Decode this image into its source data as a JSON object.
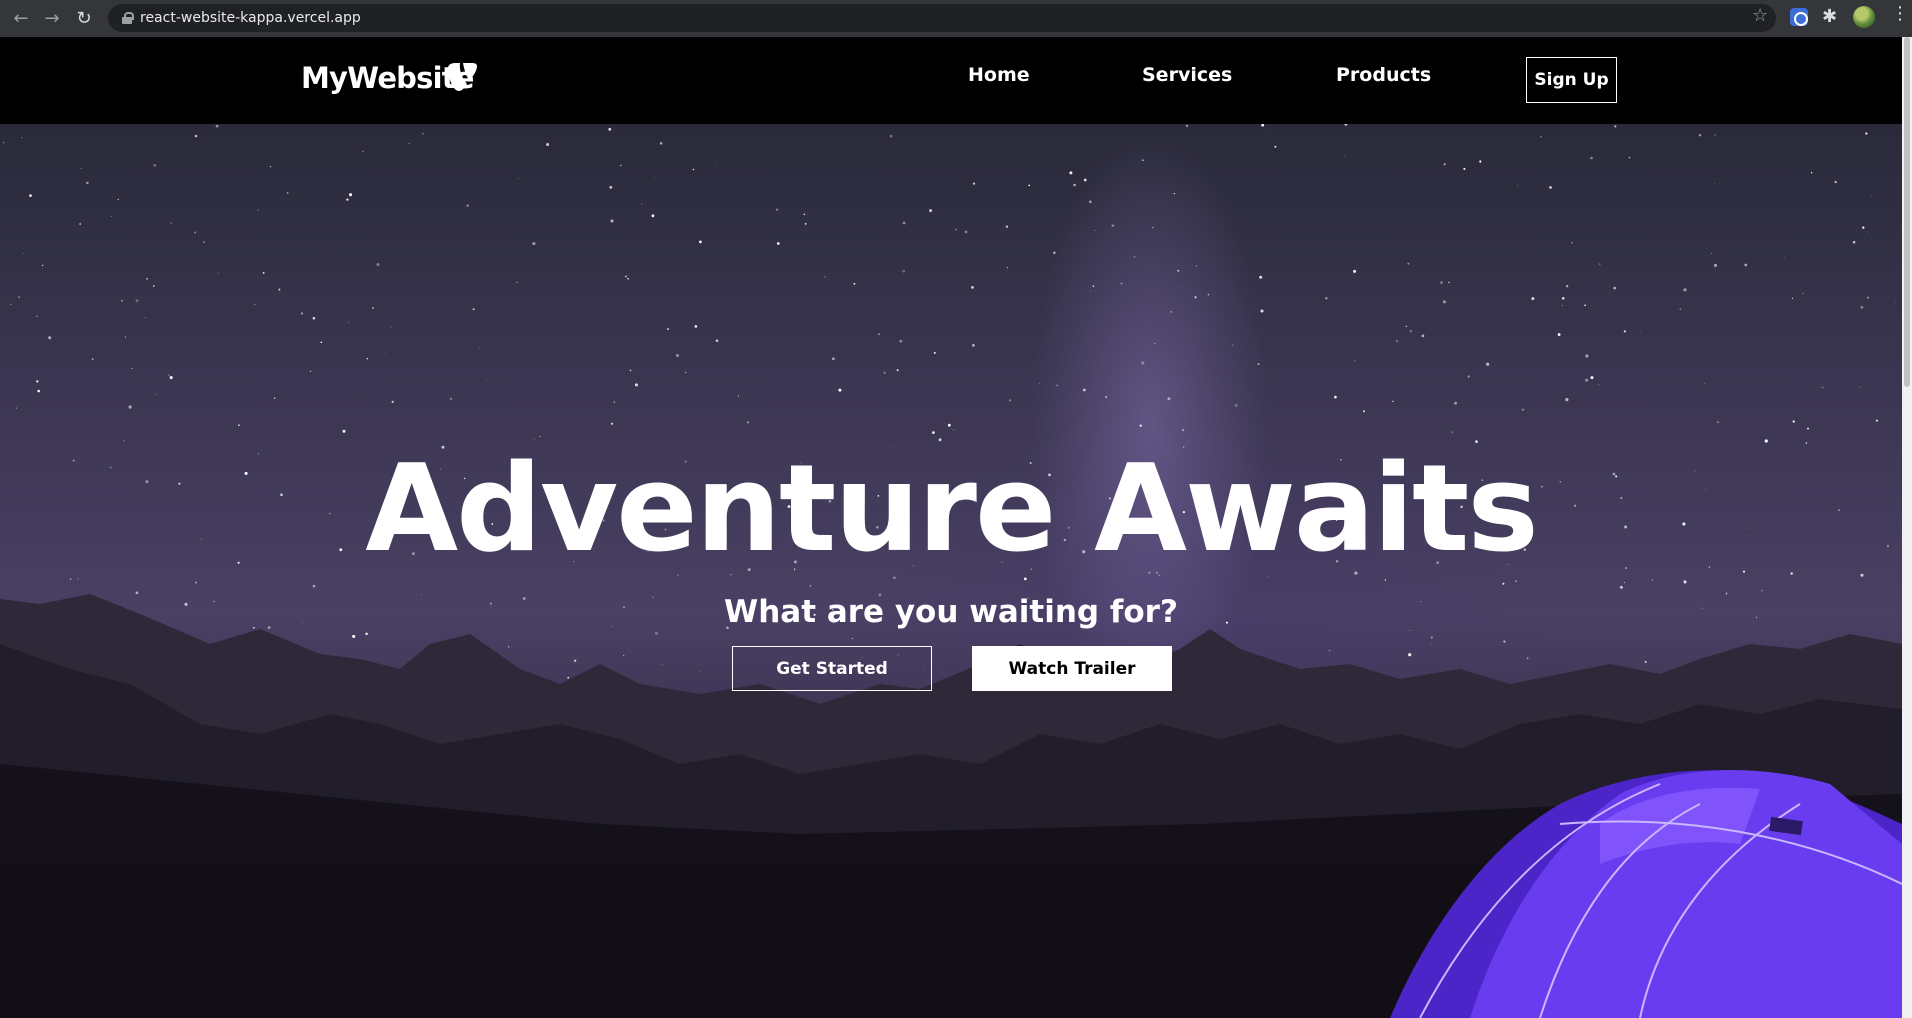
{
  "browser": {
    "url": "react-website-kappa.vercel.app",
    "back_icon": "←",
    "forward_icon": "→",
    "reload_icon": "↻",
    "star_icon": "☆",
    "extensions_icon": "✱",
    "menu_icon": "⋮"
  },
  "navbar": {
    "logo_text": "MyWebsite",
    "links": [
      "Home",
      "Services",
      "Products"
    ],
    "signup_label": "Sign Up"
  },
  "hero": {
    "title": "Adventure Awaits",
    "subtitle": "What are you waiting for?",
    "primary_button": "Get Started",
    "secondary_button": "Watch Trailer"
  },
  "colors": {
    "navbar_bg": "#000000",
    "tent": "#5b2ee0",
    "text": "#ffffff"
  }
}
